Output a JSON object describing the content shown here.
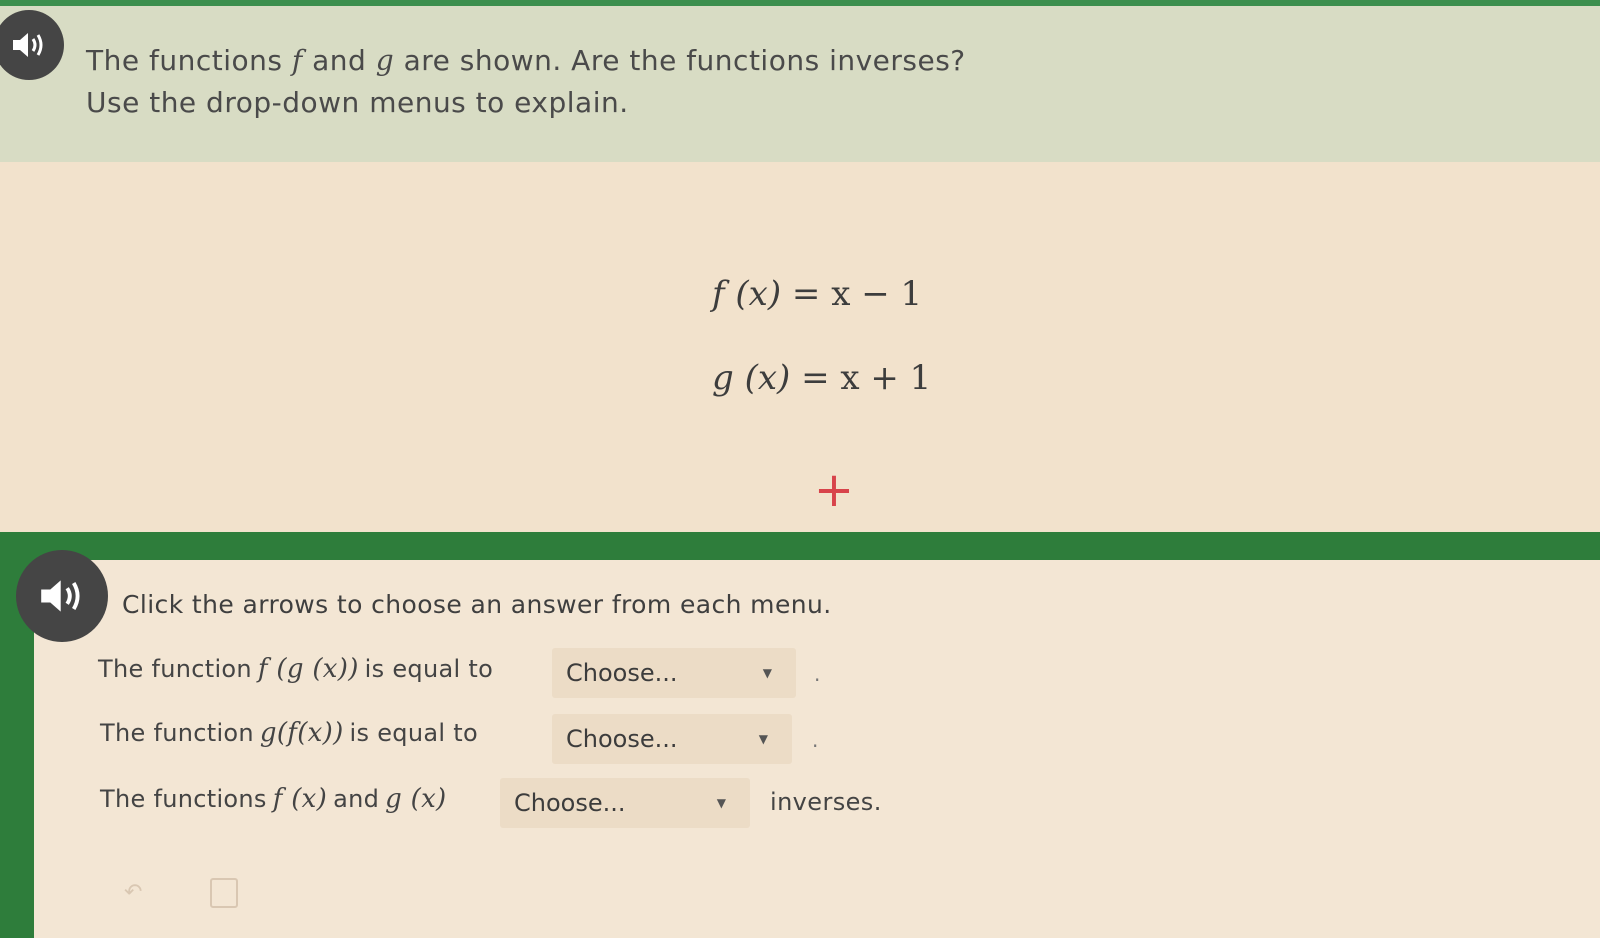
{
  "header": {
    "question_line1_pre": "The functions",
    "question_f": "f",
    "question_line1_mid": "and",
    "question_g": "g",
    "question_line1_post": "are shown. Are the functions inverses?",
    "question_line2": "Use the drop-down menus to explain.",
    "audio_icon": "speaker-icon"
  },
  "equations": {
    "f_lhs": "f (x)",
    "f_rhs": "= x − 1",
    "g_lhs": "g (x)",
    "g_rhs": "= x + 1",
    "plus_label": "+"
  },
  "answer": {
    "instruction": "Click the arrows to choose an answer from each menu.",
    "rows": [
      {
        "pre": "The function",
        "math": "f (g (x))",
        "post": "is equal to",
        "select_value": "Choose...",
        "end": "."
      },
      {
        "pre": "The function",
        "math": "g(f(x))",
        "post": "is equal to",
        "select_value": "Choose...",
        "end": "."
      },
      {
        "pre": "The functions",
        "math_a": "f (x)",
        "mid": "and",
        "math_b": "g (x)",
        "select_value": "Choose...",
        "end": "inverses."
      }
    ]
  },
  "colors": {
    "accent_green": "#2e7d3b",
    "plus_red": "#d8434a"
  }
}
